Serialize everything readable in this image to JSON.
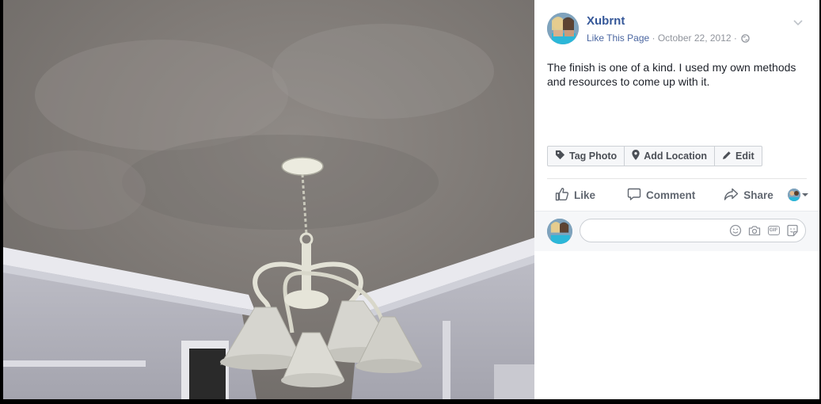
{
  "post": {
    "author": "Xubrnt",
    "like_page": "Like This Page",
    "separator": " · ",
    "date": "October 22, 2012",
    "privacy_separator": " · ",
    "text": "The finish is one of a kind. I used my own methods and resources to come up with it."
  },
  "photo_actions": {
    "tag_photo": "Tag Photo",
    "add_location": "Add Location",
    "edit": "Edit"
  },
  "reactions": {
    "like": "Like",
    "comment": "Comment",
    "share": "Share"
  },
  "comment_box": {
    "placeholder": ""
  },
  "icons": {
    "privacy": "globe-icon",
    "options": "chevron-down-icon",
    "tag": "tag-icon",
    "location": "location-pin-icon",
    "edit": "pencil-icon",
    "like": "thumbs-up-icon",
    "comment": "speech-bubble-icon",
    "share": "share-arrow-icon",
    "emoji": "smiley-icon",
    "camera": "camera-icon",
    "gif": "gif-icon",
    "sticker": "sticker-icon"
  },
  "colors": {
    "link": "#365899",
    "meta": "#90949c",
    "text": "#1d2129",
    "button_text": "#616770"
  }
}
